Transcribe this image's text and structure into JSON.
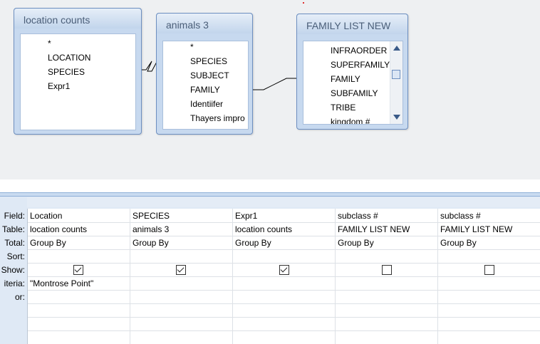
{
  "tables": [
    {
      "title": "location counts",
      "fields": [
        "*",
        "LOCATION",
        "SPECIES",
        "Expr1"
      ]
    },
    {
      "title": "animals 3",
      "fields": [
        "*",
        "SPECIES",
        "SUBJECT",
        "FAMILY",
        "Identiifer",
        "Thayers impro"
      ]
    },
    {
      "title": "FAMILY LIST NEW",
      "fields": [
        "INFRAORDER",
        "SUPERFAMILY",
        "FAMILY",
        "SUBFAMILY",
        "TRIBE",
        "kingdom #"
      ]
    }
  ],
  "grid": {
    "row_labels": [
      "Field:",
      "Table:",
      "Total:",
      "Sort:",
      "Show:",
      "iteria:",
      "or:"
    ],
    "columns": [
      {
        "field": "Location",
        "table": "location counts",
        "total": "Group By",
        "sort": "",
        "show": true,
        "criteria": "\"Montrose Point\"",
        "or": ""
      },
      {
        "field": "SPECIES",
        "table": "animals 3",
        "total": "Group By",
        "sort": "",
        "show": true,
        "criteria": "",
        "or": ""
      },
      {
        "field": "Expr1",
        "table": "location counts",
        "total": "Group By",
        "sort": "",
        "show": true,
        "criteria": "",
        "or": ""
      },
      {
        "field": "subclass #",
        "table": "FAMILY LIST NEW",
        "total": "Group By",
        "sort": "",
        "show": false,
        "criteria": "",
        "or": ""
      },
      {
        "field": "subclass #",
        "table": "FAMILY LIST NEW",
        "total": "Group By",
        "sort": "",
        "show": false,
        "criteria": "",
        "or": ""
      }
    ]
  },
  "colors": {
    "accent": "#6d8fc0",
    "title_bar": "#c7d9ef",
    "designer_bg": "#eef0f2",
    "grid_label_bg": "#dfe9f5"
  }
}
